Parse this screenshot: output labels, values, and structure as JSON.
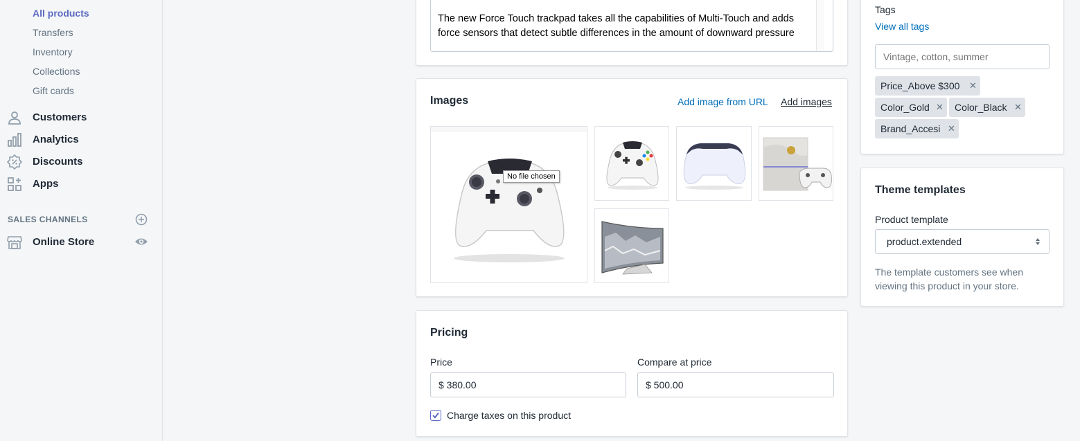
{
  "sidebar": {
    "sub_items": [
      {
        "label": "All products",
        "active": true
      },
      {
        "label": "Transfers",
        "active": false
      },
      {
        "label": "Inventory",
        "active": false
      },
      {
        "label": "Collections",
        "active": false
      },
      {
        "label": "Gift cards",
        "active": false
      }
    ],
    "nav_items": [
      {
        "label": "Customers",
        "icon": "person-icon"
      },
      {
        "label": "Analytics",
        "icon": "bar-chart-icon"
      },
      {
        "label": "Discounts",
        "icon": "discount-badge-icon"
      },
      {
        "label": "Apps",
        "icon": "apps-grid-icon"
      }
    ],
    "sales_channels_title": "SALES CHANNELS",
    "online_store_label": "Online Store"
  },
  "description": {
    "text": "The new Force Touch trackpad takes all the capabilities of Multi-Touch and adds force sensors that detect subtle differences in the amount of downward pressure"
  },
  "images": {
    "title": "Images",
    "add_from_url": "Add image from URL",
    "add_images": "Add images",
    "tooltip": "No file chosen",
    "thumbnails": [
      "white-xbox-controller",
      "xbox-controller-small",
      "white-ps-controller",
      "ps4-console-bundle",
      "curved-tv"
    ]
  },
  "pricing": {
    "title": "Pricing",
    "price_label": "Price",
    "price_value": "$ 380.00",
    "compare_label": "Compare at price",
    "compare_value": "$ 500.00",
    "charge_taxes_label": "Charge taxes on this product",
    "charge_taxes_checked": true
  },
  "tags": {
    "title": "Tags",
    "view_all": "View all tags",
    "placeholder": "Vintage, cotton, summer",
    "items": [
      "Price_Above $300",
      "Color_Gold",
      "Color_Black",
      "Brand_Accesi"
    ]
  },
  "theme": {
    "title": "Theme templates",
    "product_template_label": "Product template",
    "product_template_value": "product.extended",
    "help": "The template customers see when viewing this product in your store."
  },
  "colors": {
    "accent": "#5c6ac4",
    "link": "#006fbb",
    "background": "#f4f6f8"
  }
}
